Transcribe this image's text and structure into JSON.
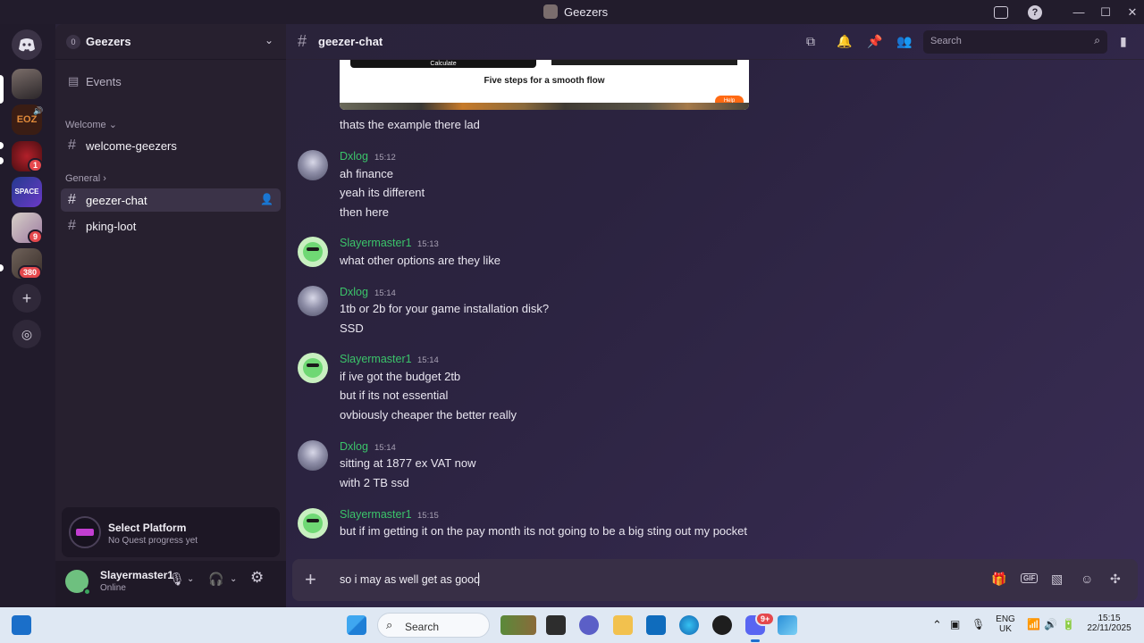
{
  "window": {
    "title": "Geezers",
    "controls": [
      "minimize",
      "maximize",
      "close"
    ]
  },
  "servers": [
    {
      "name": "discord-home",
      "badge": ""
    },
    {
      "name": "server-1",
      "badge": ""
    },
    {
      "name": "server-eoz",
      "badge": "",
      "label": "EOZ"
    },
    {
      "name": "server-3",
      "badge": "1"
    },
    {
      "name": "server-space",
      "badge": "",
      "label": "SPACE"
    },
    {
      "name": "server-5",
      "badge": "9"
    },
    {
      "name": "server-6",
      "badge": "380"
    }
  ],
  "sidebar": {
    "guild_name": "Geezers",
    "guild_count": "0",
    "events_label": "Events",
    "categories": [
      {
        "label": "Welcome",
        "chev": "⌄"
      },
      {
        "label": "General",
        "chev": "›"
      }
    ],
    "channels": [
      {
        "label": "welcome-geezers"
      },
      {
        "label": "geezer-chat"
      },
      {
        "label": "pking-loot"
      }
    ],
    "quest": {
      "title": "Select Platform",
      "subtitle": "No Quest progress yet"
    },
    "user": {
      "name": "Slayermaster1",
      "status": "Online"
    }
  },
  "chat": {
    "channel_name": "geezer-chat",
    "search_placeholder": "Search",
    "embed": {
      "button_label": "Calculate",
      "heading": "Five steps for a smooth flow",
      "help": "Help"
    },
    "messages": [
      {
        "author": "",
        "time": "",
        "lines": [
          "thats the example there lad"
        ]
      },
      {
        "author": "Dxlog",
        "time": "15:12",
        "lines": [
          "ah finance",
          "yeah its different",
          "then here"
        ]
      },
      {
        "author": "Slayermaster1",
        "time": "15:13",
        "lines": [
          "what other options are they like"
        ]
      },
      {
        "author": "Dxlog",
        "time": "15:14",
        "lines": [
          "1tb or 2b for your game installation disk?",
          "SSD"
        ]
      },
      {
        "author": "Slayermaster1",
        "time": "15:14",
        "lines": [
          "if ive got the budget 2tb",
          "but if its not essential",
          "ovbiously cheaper the better really"
        ]
      },
      {
        "author": "Dxlog",
        "time": "15:14",
        "lines": [
          "sitting at 1877 ex VAT now",
          "with 2 TB ssd"
        ]
      },
      {
        "author": "Slayermaster1",
        "time": "15:15",
        "lines": [
          "but if im getting it on the pay month its not going to be a big sting out my pocket"
        ]
      }
    ],
    "composer_value": "so i may as well get as good",
    "gif_label": "GIF"
  },
  "taskbar": {
    "search_label": "Search",
    "lang": "ENG",
    "region": "UK",
    "time": "15:15",
    "date": "22/11/2025",
    "discord_badge": "9+"
  },
  "colors": {
    "accent_green": "#3bc46a",
    "badge_red": "#e5484d",
    "background": "#2b2340"
  }
}
